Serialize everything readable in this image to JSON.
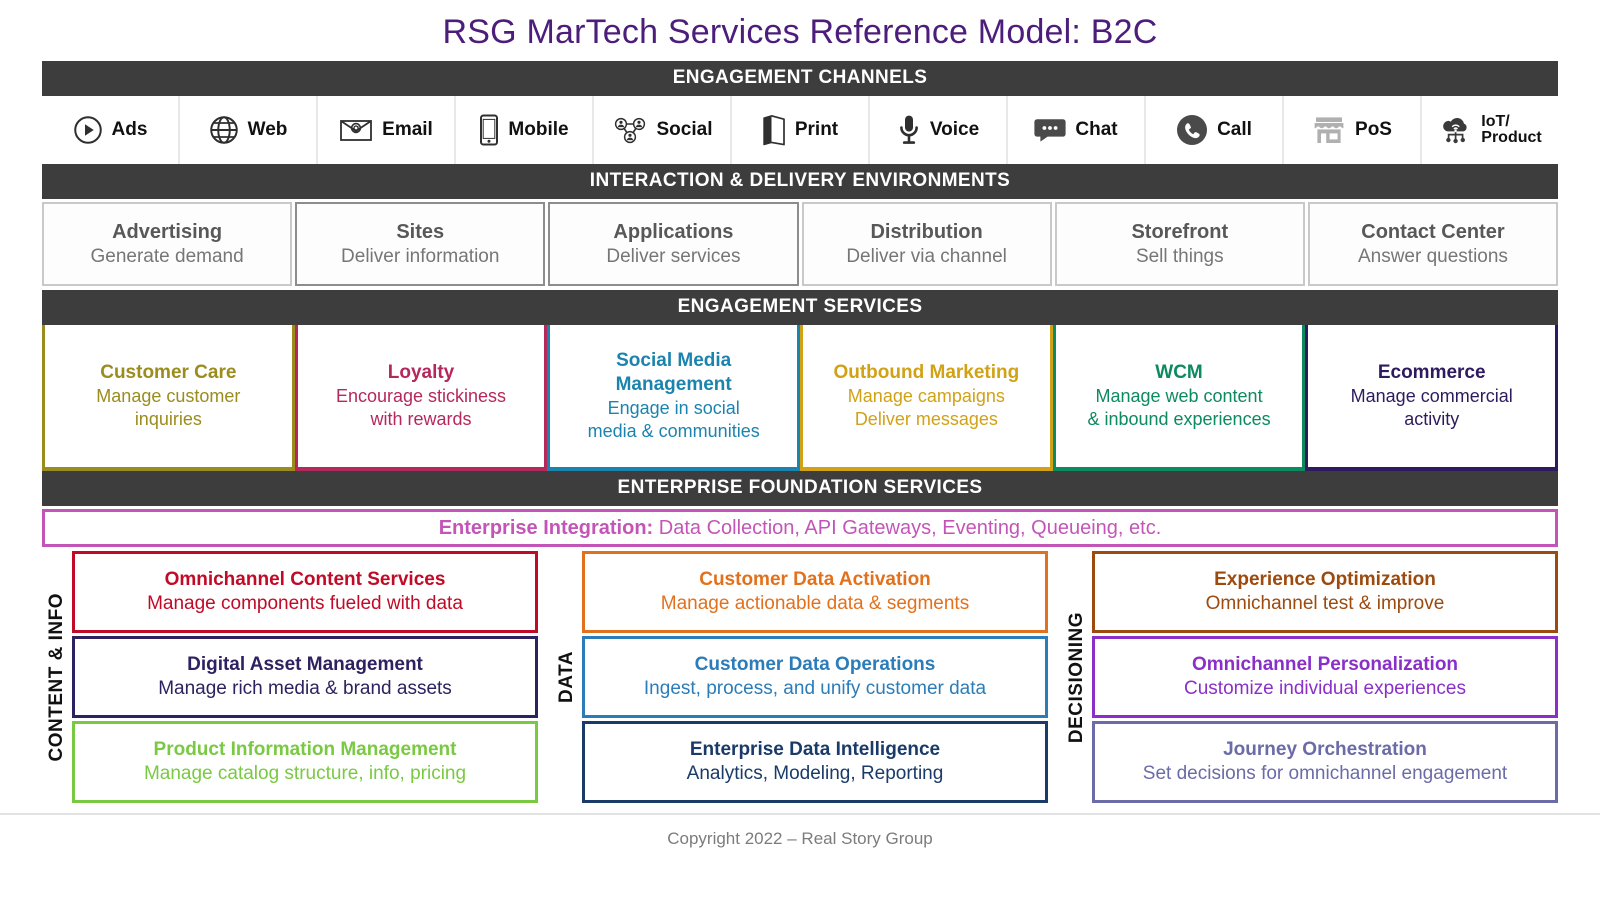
{
  "title": "RSG MarTech Services Reference Model: B2C",
  "bands": {
    "channels": "ENGAGEMENT CHANNELS",
    "interaction": "INTERACTION & DELIVERY ENVIRONMENTS",
    "engagement_services": "ENGAGEMENT SERVICES",
    "foundation": "ENTERPRISE FOUNDATION SERVICES"
  },
  "channels": [
    {
      "label": "Ads",
      "icon": "play-circle-icon"
    },
    {
      "label": "Web",
      "icon": "globe-icon"
    },
    {
      "label": "Email",
      "icon": "envelope-at-icon"
    },
    {
      "label": "Mobile",
      "icon": "smartphone-icon"
    },
    {
      "label": "Social",
      "icon": "social-network-icon"
    },
    {
      "label": "Print",
      "icon": "folded-brochure-icon"
    },
    {
      "label": "Voice",
      "icon": "microphone-icon"
    },
    {
      "label": "Chat",
      "icon": "chat-bubble-icon"
    },
    {
      "label": "Call",
      "icon": "phone-icon"
    },
    {
      "label": "PoS",
      "icon": "storefront-icon"
    },
    {
      "label": "IoT/",
      "label2": "Product",
      "icon": "iot-cloud-icon"
    }
  ],
  "environments": [
    {
      "title": "Advertising",
      "subtitle": "Generate demand"
    },
    {
      "title": "Sites",
      "subtitle": "Deliver information"
    },
    {
      "title": "Applications",
      "subtitle": "Deliver services"
    },
    {
      "title": "Distribution",
      "subtitle": "Deliver via channel"
    },
    {
      "title": "Storefront",
      "subtitle": "Sell things"
    },
    {
      "title": "Contact Center",
      "subtitle": "Answer questions"
    }
  ],
  "engagement_services": [
    {
      "title": "Customer Care",
      "lines": [
        "Manage customer",
        "inquiries"
      ],
      "color": "#9b8c1e"
    },
    {
      "title": "Loyalty",
      "lines": [
        "Encourage stickiness",
        "with rewards"
      ],
      "color": "#b5285c"
    },
    {
      "title": "Social Media Management",
      "lines": [
        "Engage in social",
        "media & communities"
      ],
      "color": "#1b84ae"
    },
    {
      "title": "Outbound Marketing",
      "lines": [
        "Manage campaigns",
        "Deliver messages"
      ],
      "color": "#d1a116"
    },
    {
      "title": "WCM",
      "lines": [
        "Manage web content",
        "& inbound experiences"
      ],
      "color": "#0d8a5f"
    },
    {
      "title": "Ecommerce",
      "lines": [
        "Manage commercial",
        "activity"
      ],
      "color": "#2e1a5e"
    }
  ],
  "enterprise_integration": {
    "bold": "Enterprise Integration:",
    "rest": " Data Collection, API Gateways, Eventing, Queueing, etc.",
    "color": "#c455b8"
  },
  "foundation_columns": [
    {
      "axis_label": "CONTENT & INFO",
      "boxes": [
        {
          "title": "Omnichannel Content Services",
          "subtitle": "Manage components fueled with data",
          "color": "#c10a27"
        },
        {
          "title": "Digital Asset Management",
          "subtitle": "Manage rich media & brand assets",
          "color": "#2e2160"
        },
        {
          "title": "Product Information Management",
          "subtitle": "Manage catalog structure, info, pricing",
          "color": "#7ac943"
        }
      ]
    },
    {
      "axis_label": "DATA",
      "boxes": [
        {
          "title": "Customer Data Activation",
          "subtitle": "Manage actionable data & segments",
          "color": "#e2711d"
        },
        {
          "title": "Customer Data Operations",
          "subtitle": "Ingest, process, and unify customer data",
          "color": "#2b7cb9"
        },
        {
          "title": "Enterprise Data Intelligence",
          "subtitle": "Analytics, Modeling, Reporting",
          "color": "#1a3a68"
        }
      ]
    },
    {
      "axis_label": "DECISIONING",
      "boxes": [
        {
          "title": "Experience Optimization",
          "subtitle": "Omnichannel test & improve",
          "color": "#9c4a0e"
        },
        {
          "title": "Omnichannel Personalization",
          "subtitle": "Customize individual experiences",
          "color": "#8b2fc9"
        },
        {
          "title": "Journey Orchestration",
          "subtitle": "Set decisions for omnichannel engagement",
          "color": "#6b6ba8"
        }
      ]
    }
  ],
  "footer": "Copyright 2022 – Real Story Group"
}
